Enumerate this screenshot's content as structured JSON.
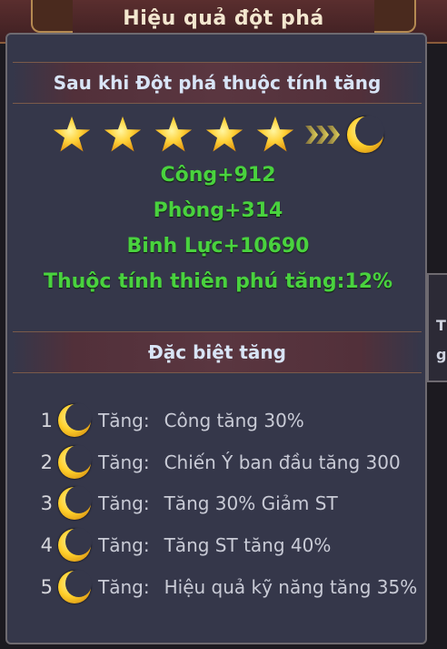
{
  "title": "Hiệu quả đột phá",
  "section1": {
    "title": "Sau khi Đột phá thuộc tính tăng"
  },
  "stars": {
    "count": 5,
    "target_icon": "moon-icon"
  },
  "stats": [
    "Công+912",
    "Phòng+314",
    "Binh Lực+10690",
    "Thuộc tính thiên phú tăng:12%"
  ],
  "section2": {
    "title": "Đặc biệt tăng"
  },
  "bonuses": [
    {
      "num": "1",
      "label": "Tăng:",
      "value": "Công tăng 30%"
    },
    {
      "num": "2",
      "label": "Tăng:",
      "value": "Chiến Ý ban đầu tăng 300"
    },
    {
      "num": "3",
      "label": "Tăng:",
      "value": "Tăng 30% Giảm ST"
    },
    {
      "num": "4",
      "label": "Tăng:",
      "value": "Tăng ST tăng 40%"
    },
    {
      "num": "5",
      "label": "Tăng:",
      "value": "Hiệu quả kỹ năng tăng 35%"
    }
  ],
  "side_panel": {
    "line1": "Tl",
    "line2": "g"
  },
  "colors": {
    "stat_green": "#49d23e",
    "panel_bg": "#35374a",
    "title_bg": "#4a2626"
  }
}
